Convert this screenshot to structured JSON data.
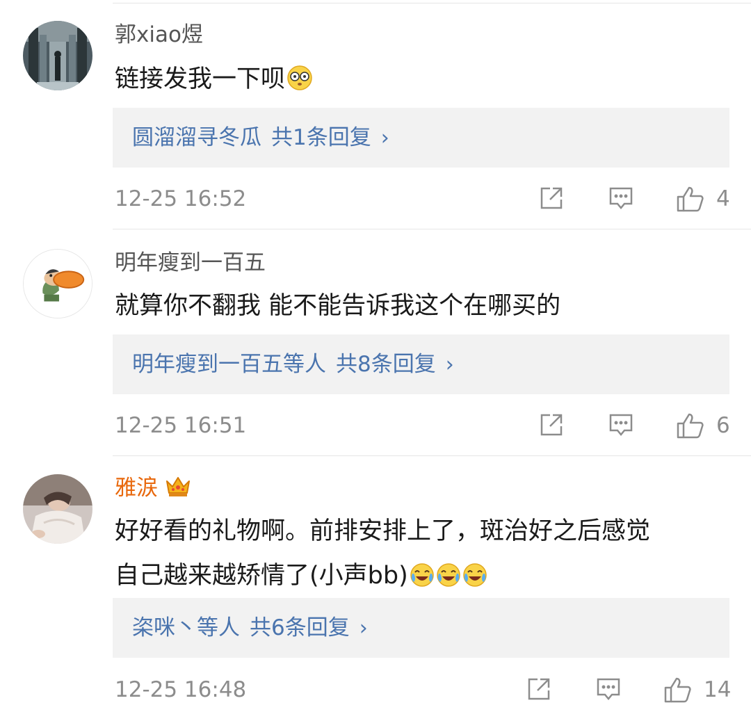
{
  "comments": [
    {
      "username": "郭xiao煜",
      "text": "链接发我一下呗",
      "emoji_icons": [
        "clueless-face-icon"
      ],
      "reply_prefix": "圆溜溜寻冬瓜",
      "reply_count": "共1条回复",
      "chevron": "›",
      "time": "12-25 16:52",
      "likes": "4"
    },
    {
      "username": "明年瘦到一百五",
      "text": "就算你不翻我 能不能告诉我这个在哪买的",
      "reply_prefix": "明年瘦到一百五等人",
      "reply_count": "共8条回复",
      "chevron": "›",
      "time": "12-25 16:51",
      "likes": "6"
    },
    {
      "username": "雅涙",
      "badge_icon": "crown-icon",
      "text_line1": "好好看的礼物啊。前排安排上了，斑治好之后感觉",
      "text_line2": "自己越来越矫情了(小声bb)",
      "emoji_icons": [
        "laugh-cry-icon",
        "laugh-cry-icon",
        "laugh-cry-icon"
      ],
      "reply_prefix": "栥咪丶等人",
      "reply_count": "共6条回复",
      "chevron": "›",
      "time": "12-25 16:48",
      "likes": "14"
    }
  ],
  "colors": {
    "username": "#555555",
    "vip_username": "#e8670b",
    "reply_link": "#4a74ae",
    "meta": "#8c8c8c",
    "reply_bg": "#f2f2f2"
  }
}
